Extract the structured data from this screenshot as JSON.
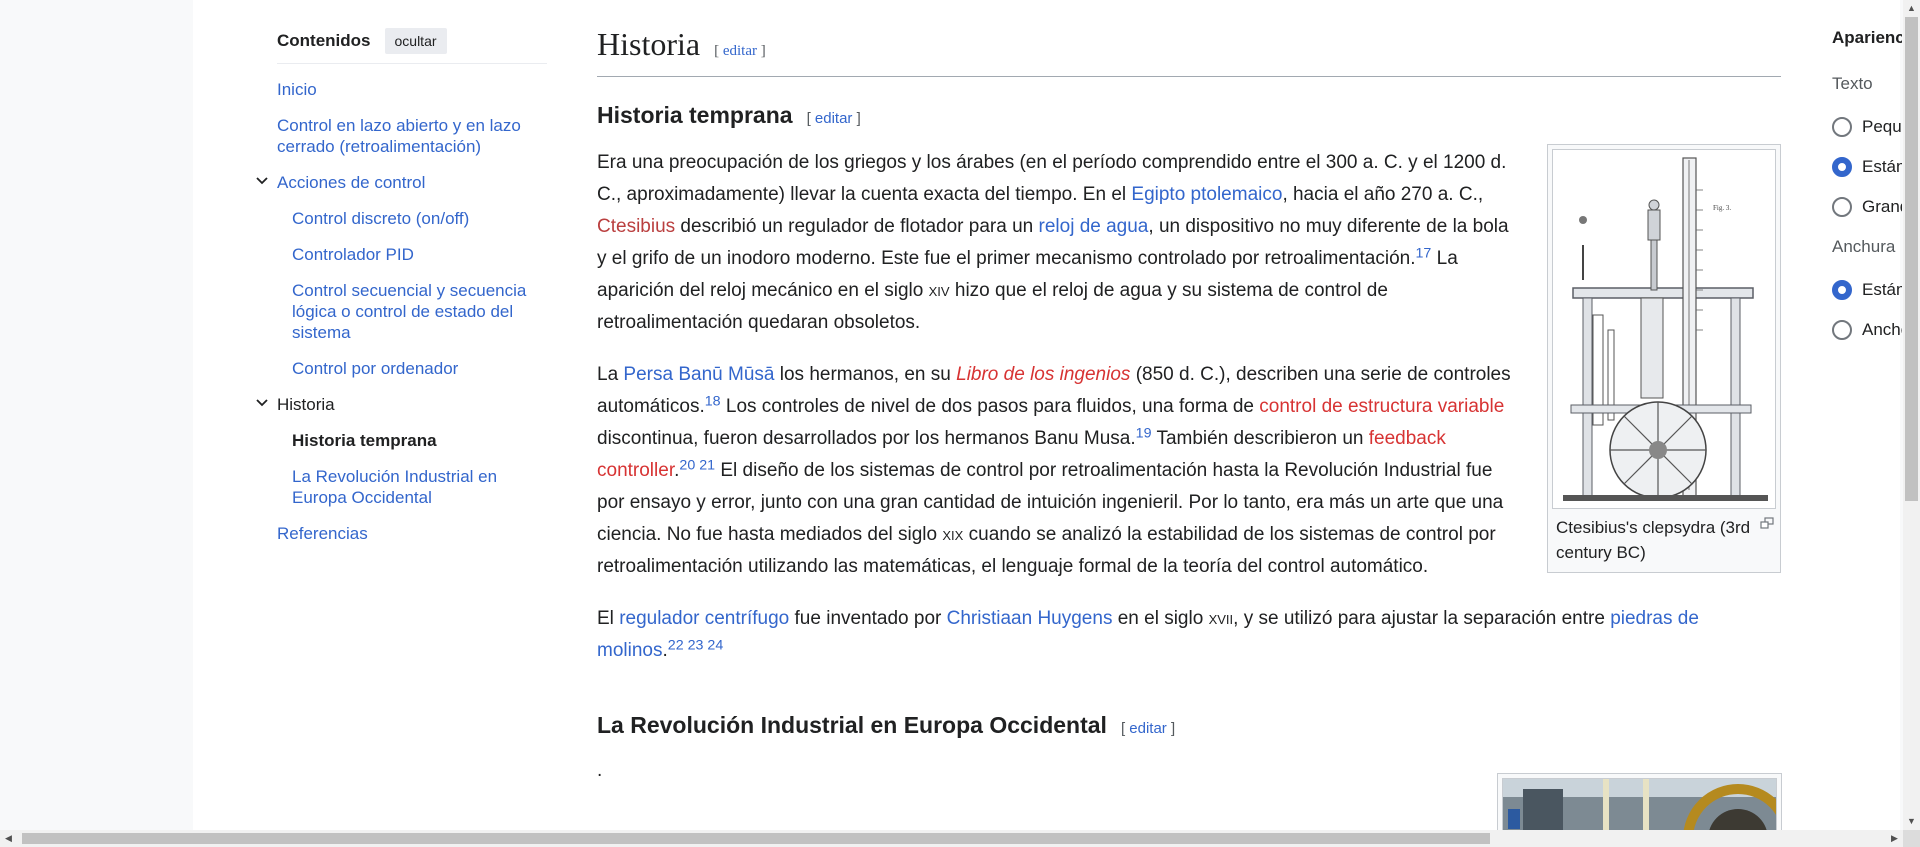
{
  "toc": {
    "title": "Contenidos",
    "hide_button": "ocultar",
    "items": [
      {
        "label": "Inicio"
      },
      {
        "label": "Control en lazo abierto y en lazo cerrado (retroalimentación)"
      },
      {
        "label": "Acciones de control"
      },
      {
        "label": "Control discreto (on/off)"
      },
      {
        "label": "Controlador PID"
      },
      {
        "label": "Control secuencial y secuencia lógica o control de estado del sistema"
      },
      {
        "label": "Control por ordenador"
      },
      {
        "label": "Historia"
      },
      {
        "label": "Historia temprana"
      },
      {
        "label": "La Revolución Industrial en Europa Occidental"
      },
      {
        "label": "Referencias"
      }
    ]
  },
  "article": {
    "section_title": "Historia",
    "edit_label": "editar",
    "subsection1_title": "Historia temprana",
    "subsection2_title": "La Revolución Industrial en Europa Occidental",
    "p1": {
      "t1": "Era una preocupación de los griegos y los árabes (en el período comprendido entre el 300 a. C. y el 1200 d. C., aproximadamente) llevar la cuenta exacta del tiempo. En el ",
      "link_egipto": "Egipto ptolemaico",
      "t2": ", hacia el año 270 a. C., ",
      "link_ctesibius": "Ctesibius",
      "t3": " describió un regulador de flotador para un ",
      "link_reloj": "reloj de agua",
      "t4": ", un dispositivo no muy diferente de la bola y el grifo de un inodoro moderno. Este fue el primer mecanismo controlado por retroalimentación.",
      "ref17": "17",
      "t5": " La aparición del reloj mecánico en el siglo ",
      "siglo1": "xiv",
      "t6": " hizo que el reloj de agua y su sistema de control de retroalimentación quedaran obsoletos."
    },
    "p2": {
      "t1": "La ",
      "link_persa": "Persa",
      "link_banu": "Banū Mūsā",
      "t2": " los hermanos, en su ",
      "link_libro": "Libro de los ingenios",
      "t3": " (850 d. C.), describen una serie de controles automáticos.",
      "ref18": "18",
      "t4": " Los controles de nivel de dos pasos para fluidos, una forma de ",
      "link_estructura": "control de estructura variable",
      "t5": " discontinua, fueron desarrollados por los hermanos Banu Musa.",
      "ref19": "19",
      "t6": " También describieron un ",
      "link_feedback": "feedback controller",
      "t7": ".",
      "ref20": "20",
      "ref21": "21",
      "t8": " El diseño de los sistemas de control por retroalimentación hasta la Revolución Industrial fue por ensayo y error, junto con una gran cantidad de intuición ingenieril. Por lo tanto, era más un arte que una ciencia. No fue hasta mediados del siglo ",
      "siglo2": "xix",
      "t9": " cuando se analizó la estabilidad de los sistemas de control por retroalimentación utilizando las matemáticas, el lenguaje formal de la teoría del control automático."
    },
    "p3": {
      "t1": "El ",
      "link_regulador": "regulador centrífugo",
      "t2": " fue inventado por ",
      "link_huygens": "Christiaan Huygens",
      "t3": " en el siglo ",
      "siglo3": "xvii",
      "t4": ", y se utilizó para ajustar la separación entre ",
      "link_piedras": "piedras de molinos",
      "t5": ".",
      "ref22": "22",
      "ref23": "23",
      "ref24": "24"
    },
    "p4": ".",
    "figure_caption": "Ctesibius's clepsydra (3rd century BC)"
  },
  "appearance": {
    "title": "Apariencia",
    "text_label": "Texto",
    "text_options": [
      "Pequeño",
      "Estándar",
      "Grande"
    ],
    "text_selected": 1,
    "width_label": "Anchura",
    "width_options": [
      "Estándar",
      "Ancho"
    ],
    "width_selected": 0
  },
  "colors": {
    "link": "#3366cc",
    "redlink": "#d73333",
    "visited_red": "#ba3f3f",
    "accent_radio": "#3366cc"
  }
}
